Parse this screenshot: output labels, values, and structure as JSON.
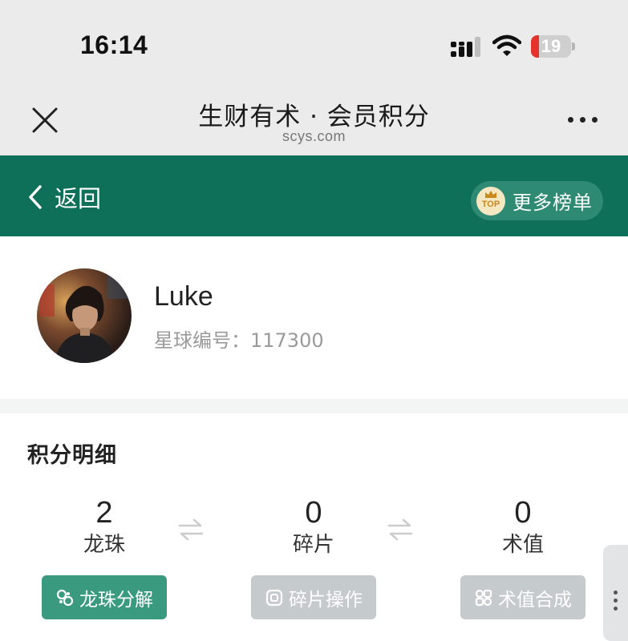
{
  "status_bar": {
    "time": "16:14",
    "battery": "19",
    "battery_level": 0.19
  },
  "title_bar": {
    "title": "生财有术 · 会员积分",
    "domain": "scys.com"
  },
  "header": {
    "back_label": "返回",
    "rank_badge": "TOP",
    "rank_label": "更多榜单"
  },
  "profile": {
    "name": "Luke",
    "member_id_label": "星球编号：",
    "member_id": "117300"
  },
  "points": {
    "title": "积分明细",
    "stats": [
      {
        "value": "2",
        "label": "龙珠"
      },
      {
        "value": "0",
        "label": "碎片"
      },
      {
        "value": "0",
        "label": "术值"
      }
    ],
    "actions": [
      {
        "label": "龙珠分解",
        "icon": "split-icon",
        "enabled": true
      },
      {
        "label": "碎片操作",
        "icon": "fragment-icon",
        "enabled": false
      },
      {
        "label": "术值合成",
        "icon": "combine-icon",
        "enabled": false
      }
    ]
  },
  "colors": {
    "brand_green": "#0e7058",
    "button_green": "#3a9a80",
    "button_disabled": "#c5cacd",
    "battery_low": "#e5322d"
  }
}
